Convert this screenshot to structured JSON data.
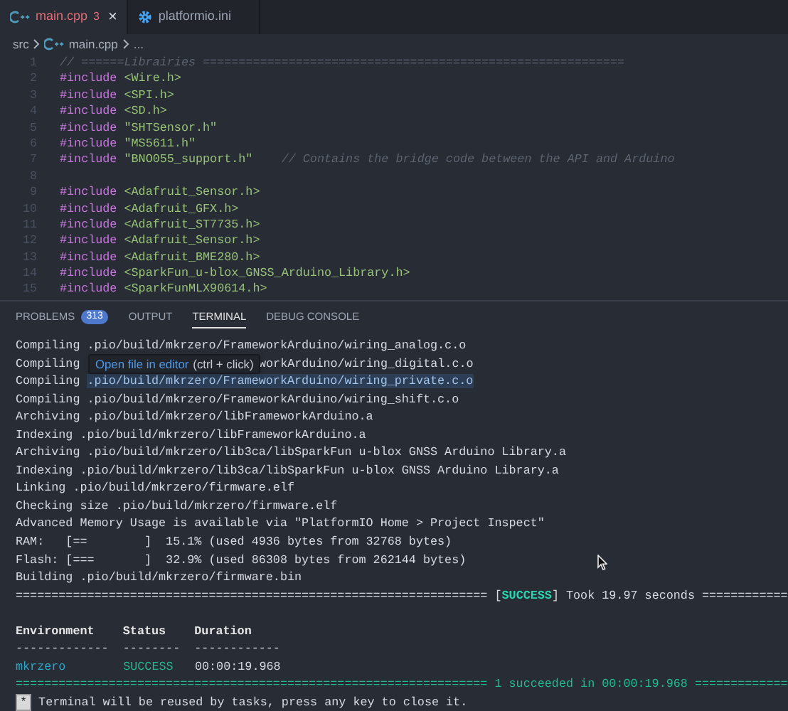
{
  "tabs": [
    {
      "label": "main.cpp",
      "badge": "3",
      "kind": "cpp",
      "selected": true,
      "has_errors": true,
      "close": "×"
    },
    {
      "label": "platformio.ini",
      "kind": "gear",
      "selected": false,
      "has_errors": false
    }
  ],
  "breadcrumb": {
    "folder": "src",
    "file": "main.cpp",
    "more": "..."
  },
  "code": [
    {
      "number": "1",
      "tokens": [
        {
          "kind": "comment",
          "text": "// ======Librairies ==========================================================="
        }
      ]
    },
    {
      "number": "2",
      "tokens": [
        {
          "kind": "keyword",
          "text": "#include"
        },
        {
          "kind": "string",
          "text": " <Wire.h>"
        }
      ]
    },
    {
      "number": "3",
      "tokens": [
        {
          "kind": "keyword",
          "text": "#include"
        },
        {
          "kind": "string",
          "text": " <SPI.h>"
        }
      ]
    },
    {
      "number": "4",
      "tokens": [
        {
          "kind": "keyword",
          "text": "#include"
        },
        {
          "kind": "string",
          "text": " <SD.h>"
        }
      ]
    },
    {
      "number": "5",
      "tokens": [
        {
          "kind": "keyword",
          "text": "#include"
        },
        {
          "kind": "string",
          "text": " \"SHTSensor.h\""
        }
      ]
    },
    {
      "number": "6",
      "tokens": [
        {
          "kind": "keyword",
          "text": "#include"
        },
        {
          "kind": "string",
          "text": " \"MS5611.h\""
        }
      ]
    },
    {
      "number": "7",
      "tokens": [
        {
          "kind": "keyword",
          "text": "#include"
        },
        {
          "kind": "string",
          "text": " \"BNO055_support.h\""
        },
        {
          "kind": "comment",
          "text": "    // Contains the bridge code between the API and Arduino"
        }
      ]
    },
    {
      "number": "8"
    },
    {
      "number": "9",
      "tokens": [
        {
          "kind": "keyword",
          "text": "#include"
        },
        {
          "kind": "string",
          "text": " <Adafruit_Sensor.h>"
        }
      ]
    },
    {
      "number": "10",
      "tokens": [
        {
          "kind": "keyword",
          "text": "#include"
        },
        {
          "kind": "string",
          "text": " <Adafruit_GFX.h>"
        }
      ]
    },
    {
      "number": "11",
      "tokens": [
        {
          "kind": "keyword",
          "text": "#include"
        },
        {
          "kind": "string",
          "text": " <Adafruit_ST7735.h>"
        }
      ]
    },
    {
      "number": "12",
      "tokens": [
        {
          "kind": "keyword",
          "text": "#include"
        },
        {
          "kind": "string",
          "text": " <Adafruit_Sensor.h>"
        }
      ]
    },
    {
      "number": "13",
      "tokens": [
        {
          "kind": "keyword",
          "text": "#include"
        },
        {
          "kind": "string",
          "text": " <Adafruit_BME280.h>"
        }
      ]
    },
    {
      "number": "14",
      "tokens": [
        {
          "kind": "keyword",
          "text": "#include"
        },
        {
          "kind": "string",
          "text": " <SparkFun_u-blox_GNSS_Arduino_Library.h>"
        }
      ]
    },
    {
      "number": "15",
      "tokens": [
        {
          "kind": "keyword",
          "text": "#include"
        },
        {
          "kind": "string",
          "text": " <SparkFunMLX90614.h>"
        }
      ]
    }
  ],
  "panel_tabs": [
    {
      "label": "PROBLEMS",
      "badge": "313",
      "selected": false
    },
    {
      "label": "OUTPUT",
      "selected": false
    },
    {
      "label": "TERMINAL",
      "selected": true
    },
    {
      "label": "DEBUG CONSOLE",
      "selected": false
    }
  ],
  "terminal": [
    {
      "segments": [
        {
          "kind": "plain",
          "text": "Compiling .pio/build/mkrzero/FrameworkArduino/wiring_analog.c.o"
        }
      ]
    },
    {
      "segments": [
        {
          "kind": "plain",
          "text": "Compiling"
        },
        {
          "kind": "after_tooltip",
          "text": "workArduino/wiring_digital.c.o"
        }
      ]
    },
    {
      "segments": [
        {
          "kind": "plain",
          "text": "Compiling "
        },
        {
          "kind": "link",
          "text": ".pio/build/mkrzero/FrameworkArduino/wiring_private.c.o"
        }
      ]
    },
    {
      "segments": [
        {
          "kind": "plain",
          "text": "Compiling .pio/build/mkrzero/FrameworkArduino/wiring_shift.c.o"
        }
      ]
    },
    {
      "segments": [
        {
          "kind": "plain",
          "text": "Archiving .pio/build/mkrzero/libFrameworkArduino.a"
        }
      ]
    },
    {
      "segments": [
        {
          "kind": "plain",
          "text": "Indexing .pio/build/mkrzero/libFrameworkArduino.a"
        }
      ]
    },
    {
      "segments": [
        {
          "kind": "plain",
          "text": "Archiving .pio/build/mkrzero/lib3ca/libSparkFun u-blox GNSS Arduino Library.a"
        }
      ]
    },
    {
      "segments": [
        {
          "kind": "plain",
          "text": "Indexing .pio/build/mkrzero/lib3ca/libSparkFun u-blox GNSS Arduino Library.a"
        }
      ]
    },
    {
      "segments": [
        {
          "kind": "plain",
          "text": "Linking .pio/build/mkrzero/firmware.elf"
        }
      ]
    },
    {
      "segments": [
        {
          "kind": "plain",
          "text": "Checking size .pio/build/mkrzero/firmware.elf"
        }
      ]
    },
    {
      "segments": [
        {
          "kind": "plain",
          "text": "Advanced Memory Usage is available via \"PlatformIO Home > Project Inspect\""
        }
      ]
    },
    {
      "segments": [
        {
          "kind": "plain",
          "text": "RAM:   [==        ]  15.1% (used 4936 bytes from 32768 bytes)"
        }
      ]
    },
    {
      "segments": [
        {
          "kind": "plain",
          "text": "Flash: [===       ]  32.9% (used 86308 bytes from 262144 bytes)"
        }
      ]
    },
    {
      "segments": [
        {
          "kind": "plain",
          "text": "Building .pio/build/mkrzero/firmware.bin"
        }
      ]
    },
    {
      "segments": [
        {
          "kind": "plain",
          "text": "================================================================== ["
        },
        {
          "kind": "success_bold",
          "text": "SUCCESS"
        },
        {
          "kind": "plain",
          "text": "] Took 19.97 seconds ============"
        }
      ]
    },
    {
      "segments": [
        {
          "kind": "bold",
          "text": "Environment    Status    Duration"
        }
      ]
    },
    {
      "segments": [
        {
          "kind": "plain",
          "text": "-------------  --------  ------------"
        }
      ]
    },
    {
      "segments": [
        {
          "kind": "env",
          "text": "mkrzero"
        },
        {
          "kind": "status",
          "text": "SUCCESS"
        },
        {
          "kind": "plain",
          "text": "00:00:19.968"
        }
      ]
    },
    {
      "segments": [
        {
          "kind": "success",
          "text": "================================================================== 1 succeeded in 00:00:19.968 ============="
        }
      ]
    },
    {
      "segments": [
        {
          "kind": "key",
          "text": "*"
        },
        {
          "kind": "plain",
          "text": " Terminal will be reused by tasks, press any key to close it."
        }
      ]
    }
  ],
  "tooltip": {
    "action": "Open file in editor",
    "hint": "(ctrl + click)"
  }
}
